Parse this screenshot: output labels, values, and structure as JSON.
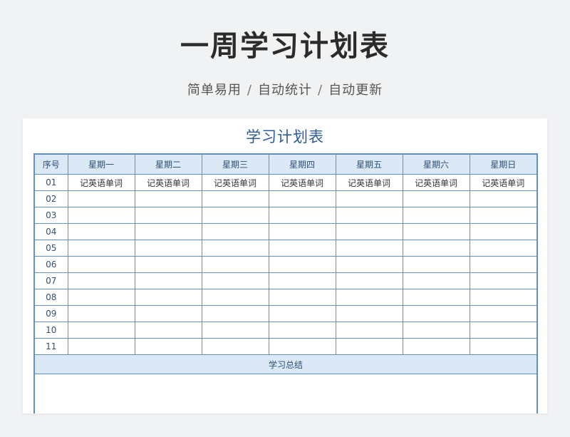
{
  "header": {
    "title": "一周学习计划表",
    "features": [
      "简单易用",
      "自动统计",
      "自动更新"
    ],
    "separator": "/"
  },
  "sheet": {
    "title": "学习计划表",
    "columns": [
      "序号",
      "星期一",
      "星期二",
      "星期三",
      "星期四",
      "星期五",
      "星期六",
      "星期日"
    ],
    "rows": [
      {
        "num": "01",
        "cells": [
          "记英语单词",
          "记英语单词",
          "记英语单词",
          "记英语单词",
          "记英语单词",
          "记英语单词",
          "记英语单词"
        ]
      },
      {
        "num": "02",
        "cells": [
          "",
          "",
          "",
          "",
          "",
          "",
          ""
        ]
      },
      {
        "num": "03",
        "cells": [
          "",
          "",
          "",
          "",
          "",
          "",
          ""
        ]
      },
      {
        "num": "04",
        "cells": [
          "",
          "",
          "",
          "",
          "",
          "",
          ""
        ]
      },
      {
        "num": "05",
        "cells": [
          "",
          "",
          "",
          "",
          "",
          "",
          ""
        ]
      },
      {
        "num": "06",
        "cells": [
          "",
          "",
          "",
          "",
          "",
          "",
          ""
        ]
      },
      {
        "num": "07",
        "cells": [
          "",
          "",
          "",
          "",
          "",
          "",
          ""
        ]
      },
      {
        "num": "08",
        "cells": [
          "",
          "",
          "",
          "",
          "",
          "",
          ""
        ]
      },
      {
        "num": "09",
        "cells": [
          "",
          "",
          "",
          "",
          "",
          "",
          ""
        ]
      },
      {
        "num": "10",
        "cells": [
          "",
          "",
          "",
          "",
          "",
          "",
          ""
        ]
      },
      {
        "num": "11",
        "cells": [
          "",
          "",
          "",
          "",
          "",
          "",
          ""
        ]
      }
    ],
    "summary_label": "学习总结",
    "summary_text": ""
  },
  "colors": {
    "border": "#5f8fc6",
    "header_bg": "#dbe8f6",
    "sheet_title": "#2d5b98"
  }
}
